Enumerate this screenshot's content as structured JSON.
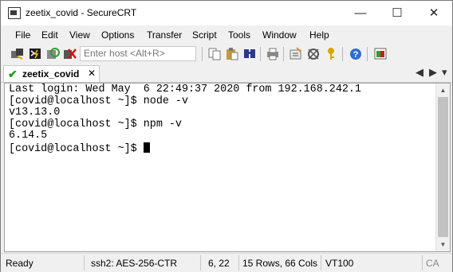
{
  "window": {
    "title": "zeetix_covid - SecureCRT",
    "controls": {
      "minimize": "—",
      "maximize": "☐",
      "close": "✕"
    }
  },
  "menu": [
    "File",
    "Edit",
    "View",
    "Options",
    "Transfer",
    "Script",
    "Tools",
    "Window",
    "Help"
  ],
  "toolbar": {
    "host_placeholder": "Enter host <Alt+R>",
    "icons": [
      "connect-icon",
      "quick-connect-icon",
      "reconnect-icon",
      "disconnect-icon",
      "copy-icon",
      "paste-icon",
      "find-icon",
      "print-icon",
      "session-options-icon",
      "global-options-icon",
      "keymap-icon",
      "help-icon",
      "sftp-icon"
    ]
  },
  "tab": {
    "label": "zeetix_covid",
    "close": "✕",
    "nav_left": "◀",
    "nav_right": "▶",
    "nav_menu": "▾"
  },
  "terminal": {
    "lines": [
      "Last login: Wed May  6 22:49:37 2020 from 192.168.242.1",
      "[covid@localhost ~]$ node -v",
      "v13.13.0",
      "[covid@localhost ~]$ npm -v",
      "6.14.5"
    ],
    "prompt": "[covid@localhost ~]$ "
  },
  "status": {
    "ready": "Ready",
    "connection": "ssh2: AES-256-CTR",
    "cursor_pos": "6, 22",
    "dimensions": "15 Rows, 66 Cols",
    "emulation": "VT100",
    "caps": "CA"
  }
}
